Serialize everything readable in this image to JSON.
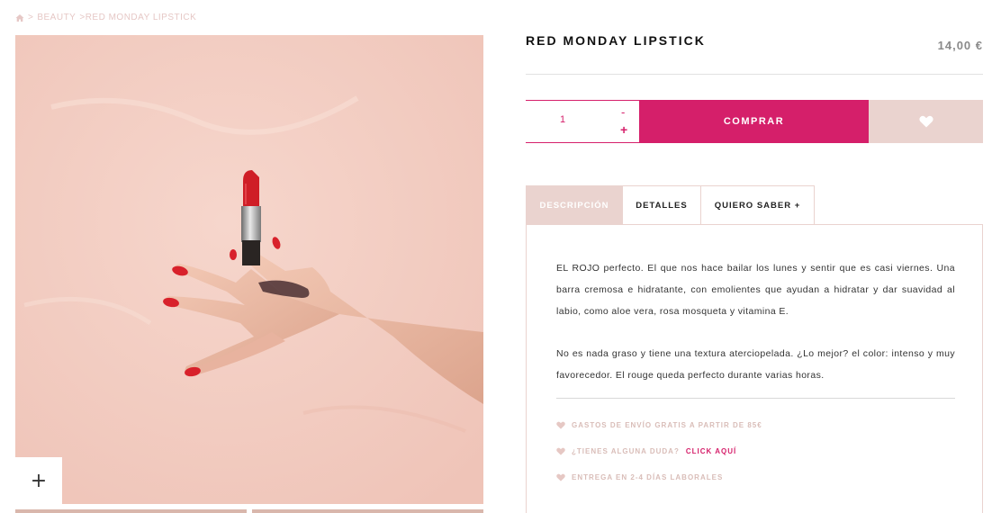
{
  "breadcrumb": {
    "home_icon": "home-icon",
    "separator": ">",
    "category": "BEAUTY",
    "current": ">RED MONDAY LIPSTICK"
  },
  "product": {
    "title": "RED MONDAY LIPSTICK",
    "price": "14,00 €",
    "image_icon": "lipstick-hand-photo"
  },
  "gallery": {
    "zoom_label": "+"
  },
  "purchase": {
    "quantity": "1",
    "minus_label": "-",
    "plus_label": "+",
    "buy_label": "COMPRAR",
    "wishlist_icon": "heart-icon"
  },
  "tabs": [
    {
      "label": "DESCRIPCIÓN",
      "active": true
    },
    {
      "label": "DETALLES",
      "active": false
    },
    {
      "label": "QUIERO SABER +",
      "active": false
    }
  ],
  "description": {
    "paragraph1": "EL ROJO perfecto. El que nos hace bailar los lunes y sentir que es casi viernes. Una barra cremosa e hidratante, con emolientes que ayudan a hidratar y dar suavidad al labio, como aloe vera, rosa mosqueta y vitamina E.",
    "paragraph2": "No es nada graso y tiene una textura aterciopelada. ¿Lo mejor? el color: intenso y muy favorecedor. El rouge queda perfecto durante varias horas."
  },
  "info": {
    "shipping": "GASTOS DE ENVÍO GRATIS A PARTIR DE 85€",
    "question": "¿TIENES ALGUNA DUDA?",
    "question_link": "CLICK AQUÍ",
    "delivery": "ENTREGA EN 2-4 DÍAS LABORALES"
  },
  "colors": {
    "accent": "#d51f6a",
    "soft_pink": "#ead3cf",
    "muted_text": "#d9bdb8"
  }
}
